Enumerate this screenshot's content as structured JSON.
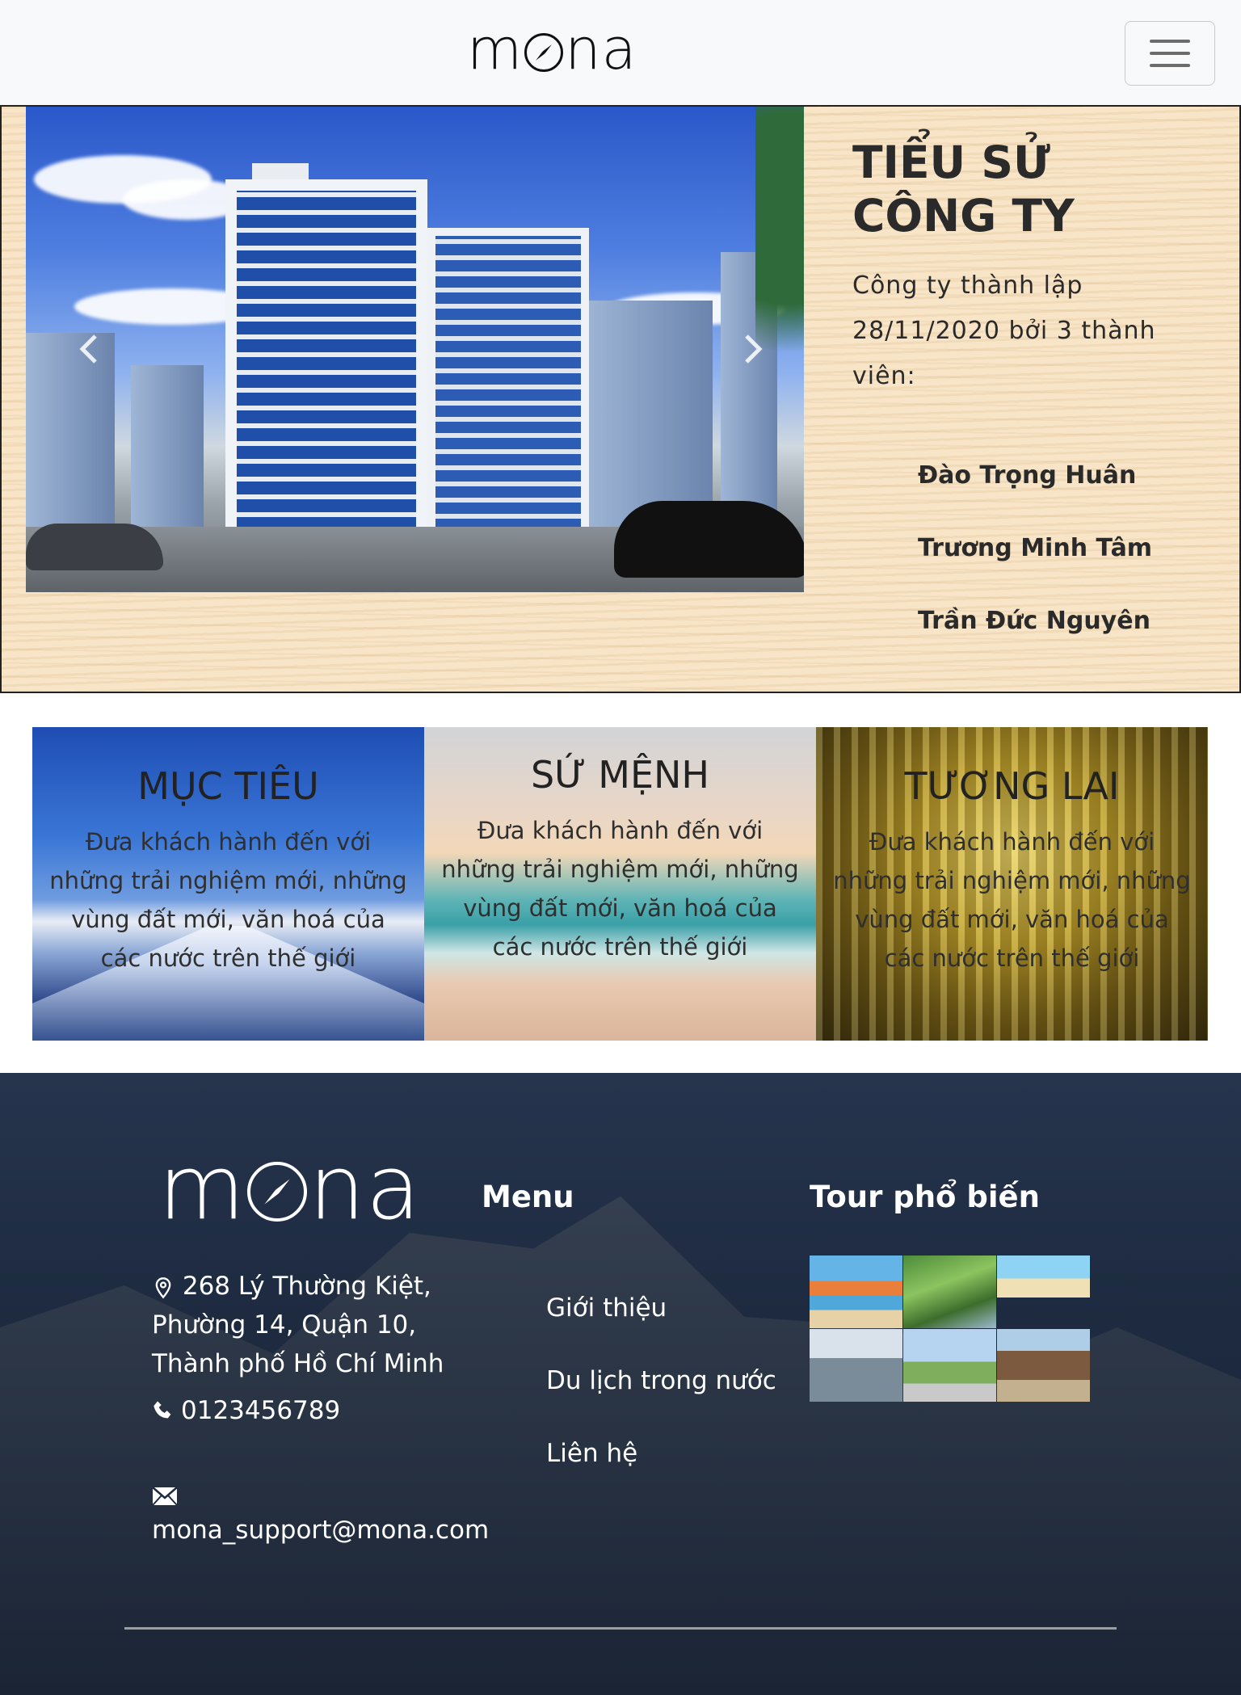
{
  "navbar": {
    "brand": "mona",
    "toggler_icon": "hamburger-icon"
  },
  "about": {
    "title": "TIỂU SỬ CÔNG TY",
    "text": "Công ty thành lập 28/11/2020 bởi 3 thành viên:",
    "members": [
      "Đào Trọng Huân",
      "Trương Minh Tâm",
      "Trần Đức Nguyên"
    ],
    "carousel_prev_icon": "chevron-left-icon",
    "carousel_next_icon": "chevron-right-icon"
  },
  "cards": [
    {
      "title": "MỤC TIÊU",
      "text": "Đưa khách hành đến với những trải nghiệm mới, những vùng đất mới, văn hoá của các nước trên thế giới"
    },
    {
      "title": "SỨ MỆNH",
      "text": "Đưa khách hành đến với những trải nghiệm mới, những vùng đất mới, văn hoá của các nước trên thế giới"
    },
    {
      "title": "TƯƠNG LAI",
      "text": "Đưa khách hành đến với những trải nghiệm mới, những vùng đất mới, văn hoá của các nước trên thế giới"
    }
  ],
  "footer": {
    "brand": "mona",
    "address": "268 Lý Thường Kiệt, Phường 14, Quận 10, Thành phố Hồ Chí Minh",
    "phone": "0123456789",
    "email": "mona_support@mona.com",
    "menu_title": "Menu",
    "menu_items": [
      "Giới thiệu",
      "Du lịch trong nước",
      "Liên hệ"
    ],
    "tour_title": "Tour phổ biến",
    "icons": {
      "address": "location-pin-icon",
      "phone": "phone-icon",
      "email": "envelope-icon"
    }
  }
}
